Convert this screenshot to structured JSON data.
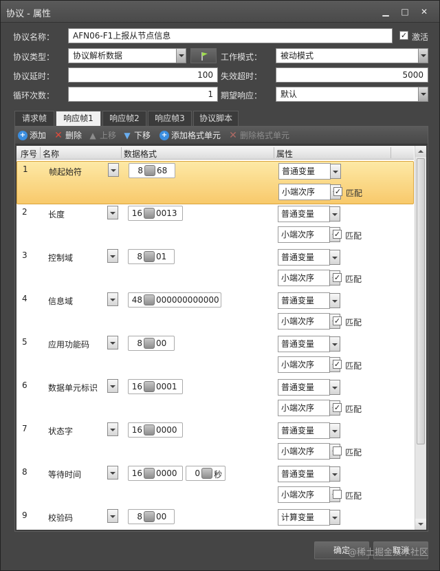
{
  "window": {
    "title": "协议 - 属性"
  },
  "form": {
    "name_label": "协议名称：",
    "name_value": "AFN06-F1上报从节点信息",
    "active_label": "激活",
    "active_checked": true,
    "type_label": "协议类型：",
    "type_value": "协议解析数据",
    "mode_label": "工作模式：",
    "mode_value": "被动模式",
    "delay_label": "协议延时：",
    "delay_value": "100",
    "timeout_label": "失效超时：",
    "timeout_value": "5000",
    "loop_label": "循环次数：",
    "loop_value": "1",
    "expect_label": "期望响应：",
    "expect_value": "默认"
  },
  "tabs": [
    {
      "label": "请求帧",
      "active": false
    },
    {
      "label": "响应帧1",
      "active": true
    },
    {
      "label": "响应帧2",
      "active": false
    },
    {
      "label": "响应帧3",
      "active": false
    },
    {
      "label": "协议脚本",
      "active": false
    }
  ],
  "toolbar": {
    "add": "添加",
    "delete": "删除",
    "up": "上移",
    "down": "下移",
    "add_format": "添加格式单元",
    "del_format": "删除格式单元"
  },
  "columns": {
    "seq": "序号",
    "name": "名称",
    "format": "数据格式",
    "attr": "属性"
  },
  "rows": [
    {
      "num": "1",
      "name": "帧起始符",
      "bits": "8",
      "hex": "68",
      "var": "普通变量",
      "order": "小端次序",
      "match_label": "匹配",
      "match": true,
      "selected": true
    },
    {
      "num": "2",
      "name": "长度",
      "bits": "16",
      "hex": "0013",
      "var": "普通变量",
      "order": "小端次序",
      "match_label": "匹配",
      "match": true
    },
    {
      "num": "3",
      "name": "控制域",
      "bits": "8",
      "hex": "01",
      "var": "普通变量",
      "order": "小端次序",
      "match_label": "匹配",
      "match": true
    },
    {
      "num": "4",
      "name": "信息域",
      "bits": "48",
      "hex": "000000000000",
      "var": "普通变量",
      "order": "小端次序",
      "match_label": "匹配",
      "match": true
    },
    {
      "num": "5",
      "name": "应用功能码",
      "bits": "8",
      "hex": "00",
      "var": "普通变量",
      "order": "小端次序",
      "match_label": "匹配",
      "match": true
    },
    {
      "num": "6",
      "name": "数据单元标识",
      "bits": "16",
      "hex": "0001",
      "var": "普通变量",
      "order": "小端次序",
      "match_label": "匹配",
      "match": true
    },
    {
      "num": "7",
      "name": "状态字",
      "bits": "16",
      "hex": "0000",
      "var": "普通变量",
      "order": "小端次序",
      "match_label": "匹配",
      "match": false
    },
    {
      "num": "8",
      "name": "等待时间",
      "bits": "16",
      "hex": "0000",
      "extra_bits": "0",
      "extra_unit": "秒",
      "var": "普通变量",
      "order": "小端次序",
      "match_label": "匹配",
      "match": false
    },
    {
      "num": "9",
      "name": "校验码",
      "bits": "8",
      "hex": "00",
      "var": "计算变量"
    }
  ],
  "buttons": {
    "ok": "确定",
    "cancel": "取消"
  },
  "watermark": "@稀土掘金技术社区"
}
